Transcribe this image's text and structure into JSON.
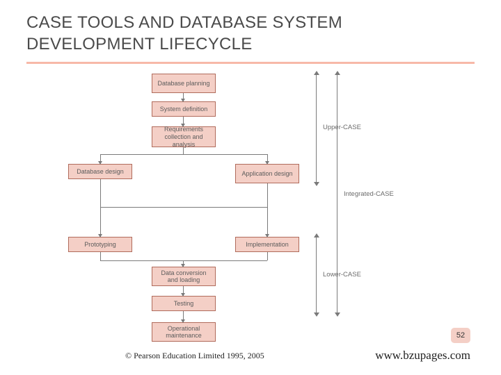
{
  "title": "CASE TOOLS AND DATABASE SYSTEM DEVELOPMENT LIFECYCLE",
  "boxes": {
    "db_planning": "Database planning",
    "sys_def": "System definition",
    "reqs": "Requirements collection and analysis",
    "db_design": "Database design",
    "app_design": "Application design",
    "prototyping": "Prototyping",
    "implementation": "Implementation",
    "data_conv": "Data conversion and loading",
    "testing": "Testing",
    "op_maint": "Operational maintenance"
  },
  "brackets": {
    "upper": "Upper-CASE",
    "lower": "Lower-CASE",
    "integrated": "Integrated-CASE"
  },
  "page_number": "52",
  "footer_left": "© Pearson Education Limited 1995, 2005",
  "footer_right": "www.bzupages.com"
}
